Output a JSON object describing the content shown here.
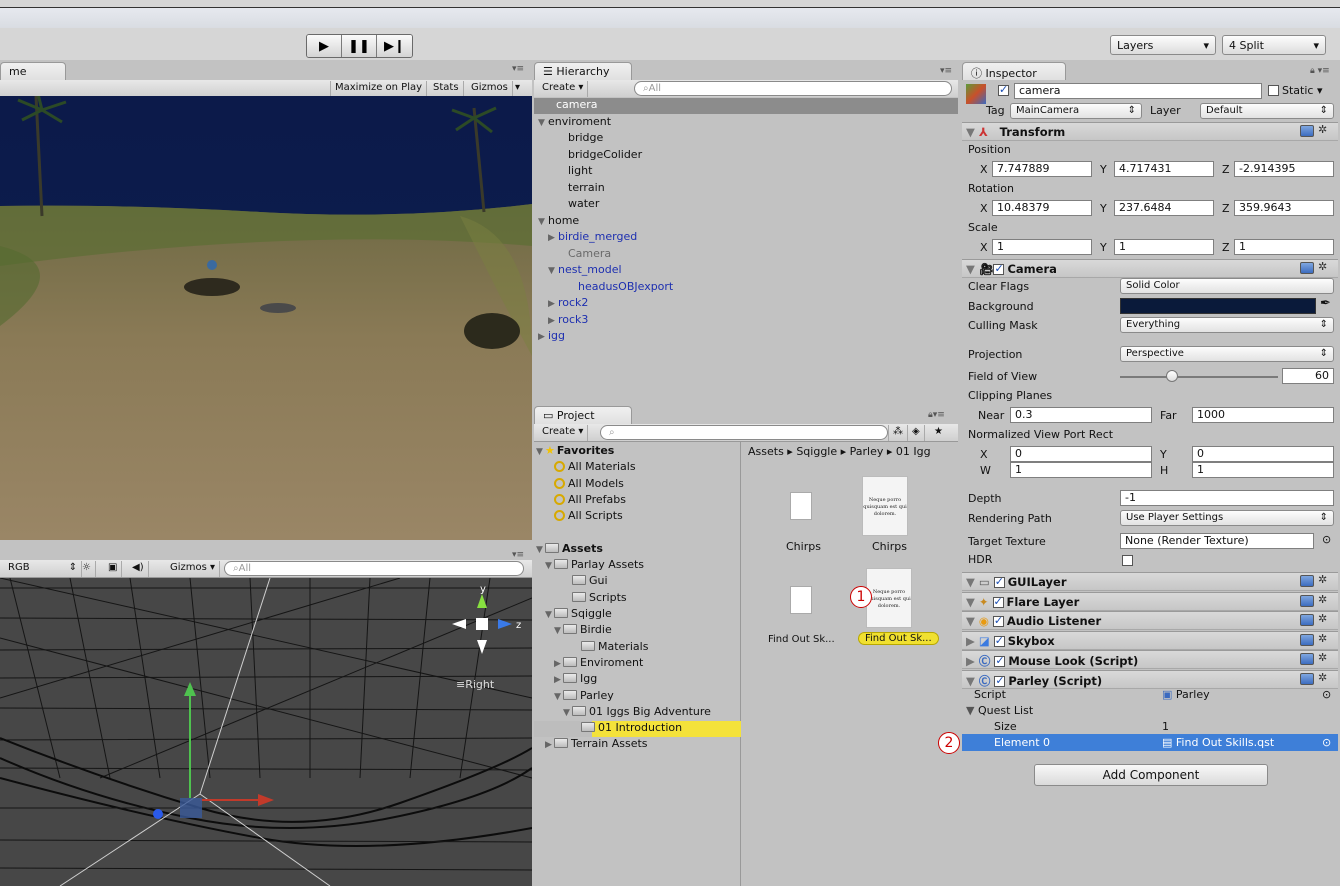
{
  "toolbar": {
    "play": "▶",
    "pause": "❚❚",
    "step": "▶❙",
    "layers": "Layers",
    "layout": "4 Split"
  },
  "game": {
    "tab": "me",
    "buttons": [
      "Maximize on Play",
      "Stats",
      "Gizmos"
    ]
  },
  "scene": {
    "render_mode": "RGB",
    "gizmos": "Gizmos",
    "search_placeholder": "All",
    "gizmo_axes": {
      "y": "y",
      "z": "z"
    },
    "view_label": "Right"
  },
  "hierarchy": {
    "tab": "Hierarchy",
    "create": "Create",
    "search_placeholder": "All",
    "items": [
      {
        "label": "camera",
        "indent": 0,
        "arrow": "",
        "style": "selected"
      },
      {
        "label": "enviroment",
        "indent": 0,
        "arrow": "▼",
        "style": "normal"
      },
      {
        "label": "bridge",
        "indent": 2,
        "arrow": "",
        "style": "normal"
      },
      {
        "label": "bridgeColider",
        "indent": 2,
        "arrow": "",
        "style": "normal"
      },
      {
        "label": "light",
        "indent": 2,
        "arrow": "",
        "style": "normal"
      },
      {
        "label": "terrain",
        "indent": 2,
        "arrow": "",
        "style": "normal"
      },
      {
        "label": "water",
        "indent": 2,
        "arrow": "",
        "style": "normal"
      },
      {
        "label": "home",
        "indent": 0,
        "arrow": "▼",
        "style": "normal"
      },
      {
        "label": "birdie_merged",
        "indent": 1,
        "arrow": "▶",
        "style": "blue"
      },
      {
        "label": "Camera",
        "indent": 2,
        "arrow": "",
        "style": "gray"
      },
      {
        "label": "nest_model",
        "indent": 1,
        "arrow": "▼",
        "style": "blue"
      },
      {
        "label": "headusOBJexport",
        "indent": 3,
        "arrow": "",
        "style": "blue"
      },
      {
        "label": "rock2",
        "indent": 1,
        "arrow": "▶",
        "style": "blue"
      },
      {
        "label": "rock3",
        "indent": 1,
        "arrow": "▶",
        "style": "blue"
      },
      {
        "label": "igg",
        "indent": 0,
        "arrow": "▶",
        "style": "blue"
      }
    ]
  },
  "project": {
    "tab": "Project",
    "create": "Create",
    "breadcrumb": "Assets ▸ Sqiggle ▸ Parley ▸ 01 Igg",
    "tree": [
      {
        "label": "Favorites",
        "indent": 0,
        "arrow": "▼",
        "icon": "star",
        "bold": true
      },
      {
        "label": "All Materials",
        "indent": 1,
        "arrow": "",
        "icon": "search",
        "bold": false
      },
      {
        "label": "All Models",
        "indent": 1,
        "arrow": "",
        "icon": "search",
        "bold": false
      },
      {
        "label": "All Prefabs",
        "indent": 1,
        "arrow": "",
        "icon": "search",
        "bold": false
      },
      {
        "label": "All Scripts",
        "indent": 1,
        "arrow": "",
        "icon": "search",
        "bold": false
      },
      {
        "label": "",
        "indent": 0,
        "arrow": "",
        "icon": "none",
        "bold": false
      },
      {
        "label": "Assets",
        "indent": 0,
        "arrow": "▼",
        "icon": "folder",
        "bold": true
      },
      {
        "label": "Parlay Assets",
        "indent": 1,
        "arrow": "▼",
        "icon": "folder",
        "bold": false
      },
      {
        "label": "Gui",
        "indent": 3,
        "arrow": "",
        "icon": "folder",
        "bold": false
      },
      {
        "label": "Scripts",
        "indent": 3,
        "arrow": "",
        "icon": "folder",
        "bold": false
      },
      {
        "label": "Sqiggle",
        "indent": 1,
        "arrow": "▼",
        "icon": "folder",
        "bold": false
      },
      {
        "label": "Birdie",
        "indent": 2,
        "arrow": "▼",
        "icon": "folder",
        "bold": false
      },
      {
        "label": "Materials",
        "indent": 4,
        "arrow": "",
        "icon": "folder",
        "bold": false
      },
      {
        "label": "Enviroment",
        "indent": 2,
        "arrow": "▶",
        "icon": "folder",
        "bold": false
      },
      {
        "label": "Igg",
        "indent": 2,
        "arrow": "▶",
        "icon": "folder",
        "bold": false
      },
      {
        "label": "Parley",
        "indent": 2,
        "arrow": "▼",
        "icon": "folder",
        "bold": false
      },
      {
        "label": "01 Iggs Big Adventure",
        "indent": 3,
        "arrow": "▼",
        "icon": "folder",
        "bold": false
      },
      {
        "label": "01 Introduction",
        "indent": 4,
        "arrow": "",
        "icon": "folder",
        "bold": false,
        "selected": true
      },
      {
        "label": "Terrain Assets",
        "indent": 1,
        "arrow": "▶",
        "icon": "folder",
        "bold": false
      }
    ],
    "files": [
      {
        "label": "Chirps",
        "kind": "script"
      },
      {
        "label": "Chirps",
        "kind": "quest",
        "preview": "Neque porro quisquam est qui dolorem."
      },
      {
        "label": "Find Out Sk...",
        "kind": "script"
      },
      {
        "label": "Find Out Sk...",
        "kind": "quest",
        "preview": "Neque porro quisquam est qui dolorem.",
        "selected": true
      }
    ]
  },
  "inspector": {
    "tab": "Inspector",
    "object_name": "camera",
    "static": "Static",
    "tag_label": "Tag",
    "tag": "MainCamera",
    "layer_label": "Layer",
    "layer": "Default",
    "transform": {
      "title": "Transform",
      "position_label": "Position",
      "rotation_label": "Rotation",
      "scale_label": "Scale",
      "axis_x": "X",
      "axis_y": "Y",
      "axis_z": "Z",
      "position": [
        "7.747889",
        "4.717431",
        "-2.914395"
      ],
      "rotation": [
        "10.48379",
        "237.6484",
        "359.9643"
      ],
      "scale": [
        "1",
        "1",
        "1"
      ]
    },
    "camera": {
      "title": "Camera",
      "clear_flags_label": "Clear Flags",
      "clear_flags": "Solid Color",
      "background_label": "Background",
      "background_color": "#0a1a3a",
      "culling_label": "Culling Mask",
      "culling": "Everything",
      "projection_label": "Projection",
      "projection": "Perspective",
      "fov_label": "Field of View",
      "fov": "60",
      "fov_fraction": 0.33,
      "clipping_label": "Clipping Planes",
      "near_label": "Near",
      "near": "0.3",
      "far_label": "Far",
      "far": "1000",
      "viewport_label": "Normalized View Port Rect",
      "vp_x_label": "X",
      "vp_x": "0",
      "vp_y_label": "Y",
      "vp_y": "0",
      "vp_w_label": "W",
      "vp_w": "1",
      "vp_h_label": "H",
      "vp_h": "1",
      "depth_label": "Depth",
      "depth": "-1",
      "render_path_label": "Rendering Path",
      "render_path": "Use Player Settings",
      "target_label": "Target Texture",
      "target": "None (Render Texture)",
      "hdr_label": "HDR"
    },
    "components": [
      "GUILayer",
      "Flare Layer",
      "Audio Listener",
      "Skybox",
      "Mouse Look (Script)",
      "Parley (Script)"
    ],
    "parley": {
      "script_label": "Script",
      "script": "Parley",
      "quest_list": "Quest List",
      "size_label": "Size",
      "size": "1",
      "element_label": "Element 0",
      "element": "Find Out Skills.qst"
    },
    "add_component": "Add Component"
  },
  "callouts": [
    "1",
    "2"
  ]
}
